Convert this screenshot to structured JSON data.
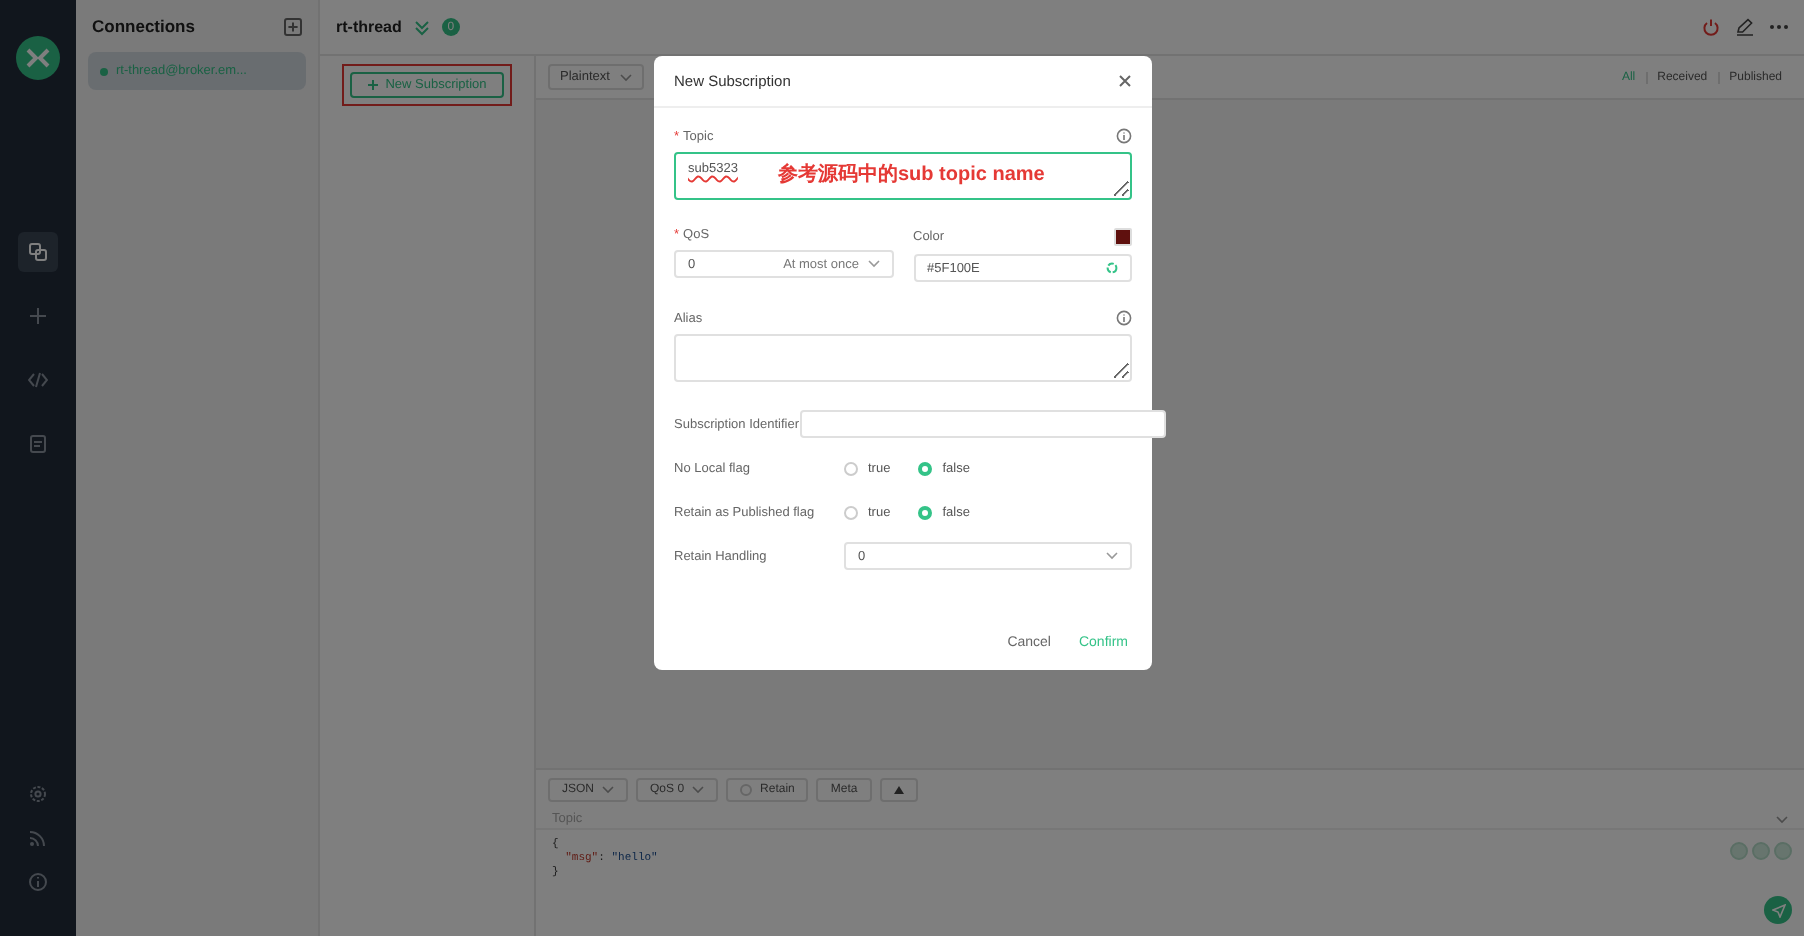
{
  "nav_items": [
    {
      "selected": true
    },
    {
      "selected": false
    },
    {
      "selected": false
    },
    {
      "selected": false
    }
  ],
  "connections": {
    "title": "Connections",
    "items": [
      {
        "name": "rt-thread@broker.em...",
        "selected": true,
        "online": true
      }
    ]
  },
  "header": {
    "title": "rt-thread",
    "badge": "0"
  },
  "subscriptions": {
    "new_button": "New Subscription",
    "highlighted": true
  },
  "messages": {
    "format": "Plaintext",
    "filters": [
      {
        "label": "All",
        "selected": true
      },
      {
        "label": "Received",
        "selected": false
      },
      {
        "label": "Published",
        "selected": false
      }
    ]
  },
  "publish": {
    "format": "JSON",
    "qos": "QoS 0",
    "retain": {
      "label": "Retain",
      "checked": false
    },
    "meta": "Meta",
    "topic_placeholder": "Topic",
    "payload": {
      "open": "{",
      "key": "\"msg\"",
      "colon": ":",
      "value": "\"hello\"",
      "close": "}"
    }
  },
  "dialog": {
    "title": "New Subscription",
    "topic": {
      "label": "Topic",
      "required_mark": "*",
      "value": "sub5323"
    },
    "annotation": "参考源码中的sub topic name",
    "qos": {
      "label": "QoS",
      "required_mark": "*",
      "value": "0",
      "description": "At most once"
    },
    "color": {
      "label": "Color",
      "value": "#5F100E"
    },
    "alias": {
      "label": "Alias"
    },
    "subscription_identifier": {
      "label": "Subscription Identifier"
    },
    "flags": [
      {
        "label": "No Local flag",
        "options": [
          {
            "label": "true",
            "selected": false
          },
          {
            "label": "false",
            "selected": true
          }
        ]
      },
      {
        "label": "Retain as Published flag",
        "options": [
          {
            "label": "true",
            "selected": false
          },
          {
            "label": "false",
            "selected": true
          }
        ]
      }
    ],
    "retain_handling": {
      "label": "Retain Handling",
      "value": "0"
    },
    "buttons": {
      "cancel": "Cancel",
      "confirm": "Confirm"
    }
  }
}
